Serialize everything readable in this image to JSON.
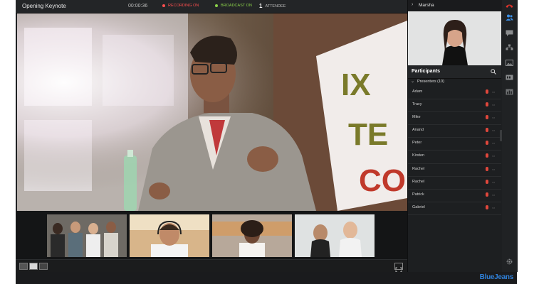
{
  "meeting": {
    "title": "Opening Keynote",
    "timer": "00:00:36",
    "recording": "RECORDING ON",
    "broadcast": "BROADCAST ON",
    "attendee_count": "1",
    "attendees_label": "ATTENDEE"
  },
  "self_view": {
    "name": "Marsha"
  },
  "participants": {
    "title": "Participants",
    "group_label": "Presenters (10)",
    "presenters": [
      "Adam",
      "Tracy",
      "Mike",
      "Anand",
      "Peter",
      "Kirsten",
      "Rachel",
      "Rachel",
      "Patrick",
      "Gabriel"
    ]
  },
  "video_sign_text": "IX TE CO",
  "brand": "BlueJeans",
  "colors": {
    "recording": "#ff4f4f",
    "broadcast": "#8bd14a",
    "brand_blue": "#2f7fd6",
    "mic": "#e0473c",
    "hangup": "#e0342b"
  },
  "icons": {
    "strip": [
      "phone-hangup-icon",
      "participants-icon",
      "chat-icon",
      "share-icon",
      "gallery-icon",
      "captions-icon",
      "stats-icon",
      "settings-icon"
    ]
  }
}
